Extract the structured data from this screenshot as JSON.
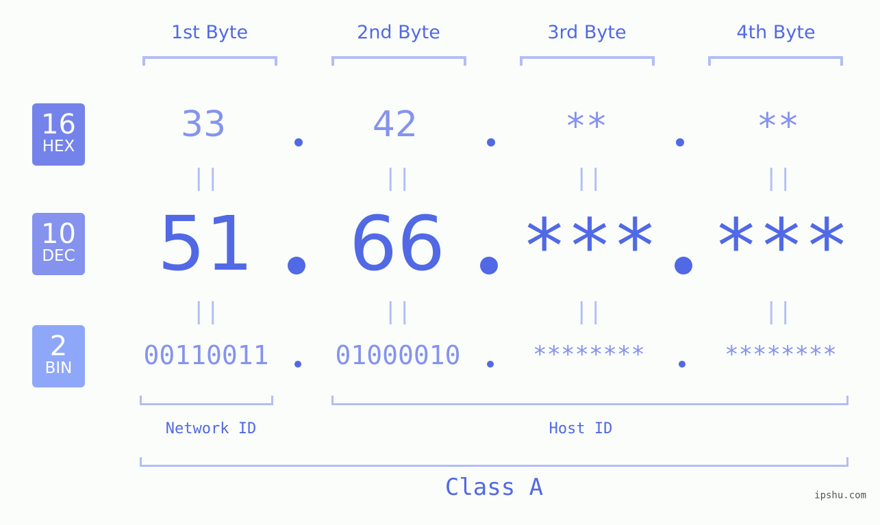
{
  "bytes": {
    "headers": [
      "1st Byte",
      "2nd Byte",
      "3rd Byte",
      "4th Byte"
    ]
  },
  "bases": [
    {
      "number": "16",
      "label": "HEX",
      "color": "#7383ea"
    },
    {
      "number": "10",
      "label": "DEC",
      "color": "#8593ee"
    },
    {
      "number": "2",
      "label": "BIN",
      "color": "#8fa7f8"
    }
  ],
  "hex": [
    "33",
    "42",
    "**",
    "**"
  ],
  "dec": [
    "51",
    "66",
    "***",
    "***"
  ],
  "bin": [
    "00110011",
    "01000010",
    "********",
    "********"
  ],
  "equals_symbol": "||",
  "network_label": "Network ID",
  "host_label": "Host ID",
  "class_label": "Class A",
  "site": "ipshu.com",
  "colors": {
    "primary": "#5169e4",
    "secondary": "#8593ee",
    "bracket": "#b3bdf5",
    "background": "#fbfdfb"
  }
}
